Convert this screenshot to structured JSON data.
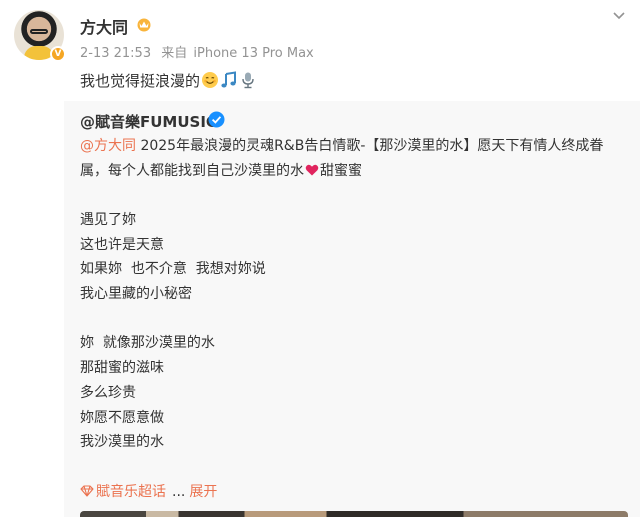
{
  "post": {
    "username": "方大同",
    "date": "2-13 21:53",
    "source_prefix": "来自",
    "device": "iPhone 13 Pro Max",
    "text": "我也觉得挺浪漫的",
    "emojis": [
      "smiling-face-emoji",
      "music-note-emoji",
      "microphone-emoji"
    ]
  },
  "repost": {
    "author": "@賦音樂FUMUSIC",
    "mention": "@方大同",
    "body_part1": " 2025年最浪漫的灵魂R&B告白情歌-【那沙漠里的水】愿天下有情人终成眷属，每个人都能找到自己沙漠里的水",
    "body_part2": "甜蜜蜜",
    "lyrics": [
      "遇见了妳",
      "这也许是天意",
      "如果妳  也不介意  我想对妳说",
      "我心里藏的小秘密",
      "",
      "妳  就像那沙漠里的水",
      "那甜蜜的滋味",
      "多么珍贵",
      "妳愿不愿意做",
      "我沙漠里的水"
    ],
    "super_topic": "賦音乐超话",
    "ellipsis": "...",
    "expand": "展开"
  },
  "colors": {
    "accent": "#eb7350",
    "meta_gray": "#939393",
    "repost_bg": "#f8f8f8",
    "verify_blue": "#1890ff",
    "verify_orange": "#f5a623"
  }
}
